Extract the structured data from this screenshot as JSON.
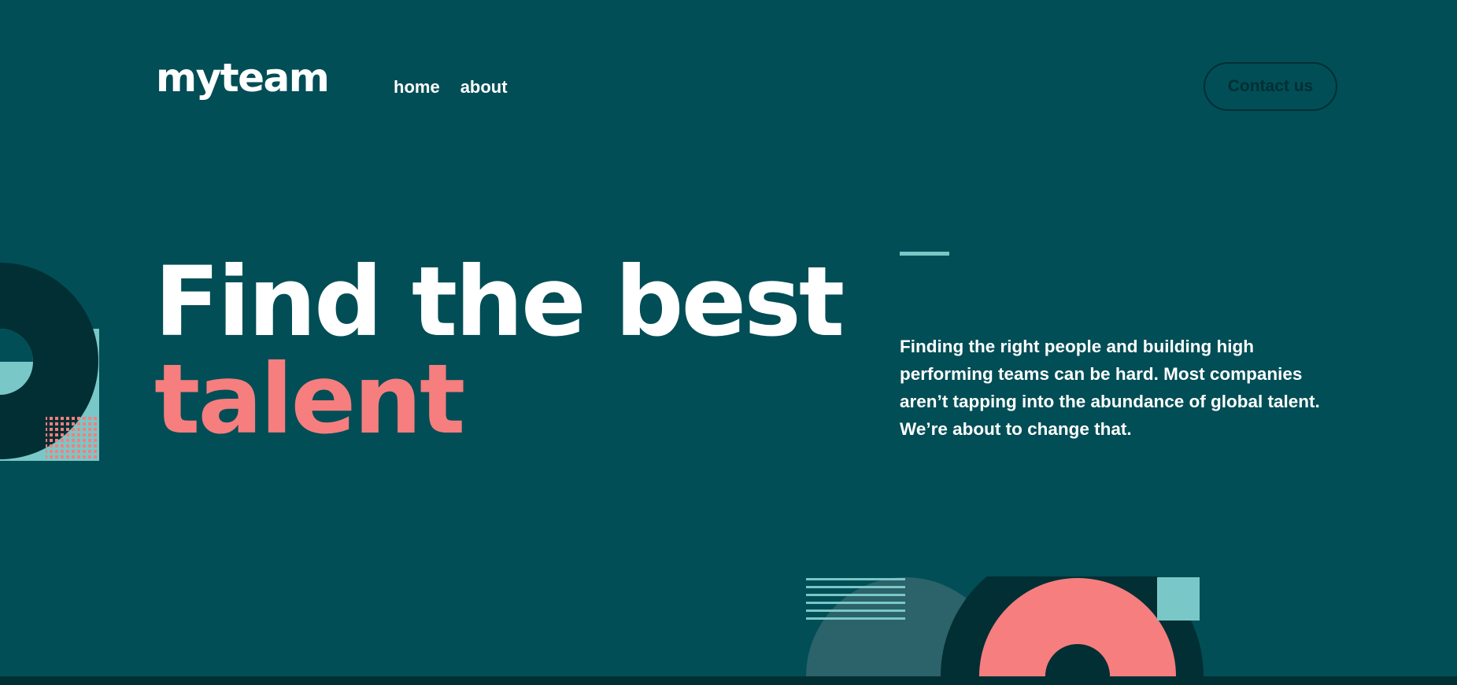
{
  "header": {
    "logo": "myteam",
    "nav": [
      {
        "label": "home"
      },
      {
        "label": "about"
      }
    ],
    "contact_label": "Contact us"
  },
  "hero": {
    "title_line1": "Find the best",
    "title_line2": "talent",
    "description": "Finding the right people and building high performing teams can be hard. Most companies aren’t tapping into the abundance of global talent. We’re about to change that."
  },
  "colors": {
    "background": "#014e56",
    "dark": "#012f34",
    "coral": "#f67e7e",
    "teal": "#79c8c7",
    "muted_teal": "#2c6269",
    "white": "#ffffff"
  }
}
